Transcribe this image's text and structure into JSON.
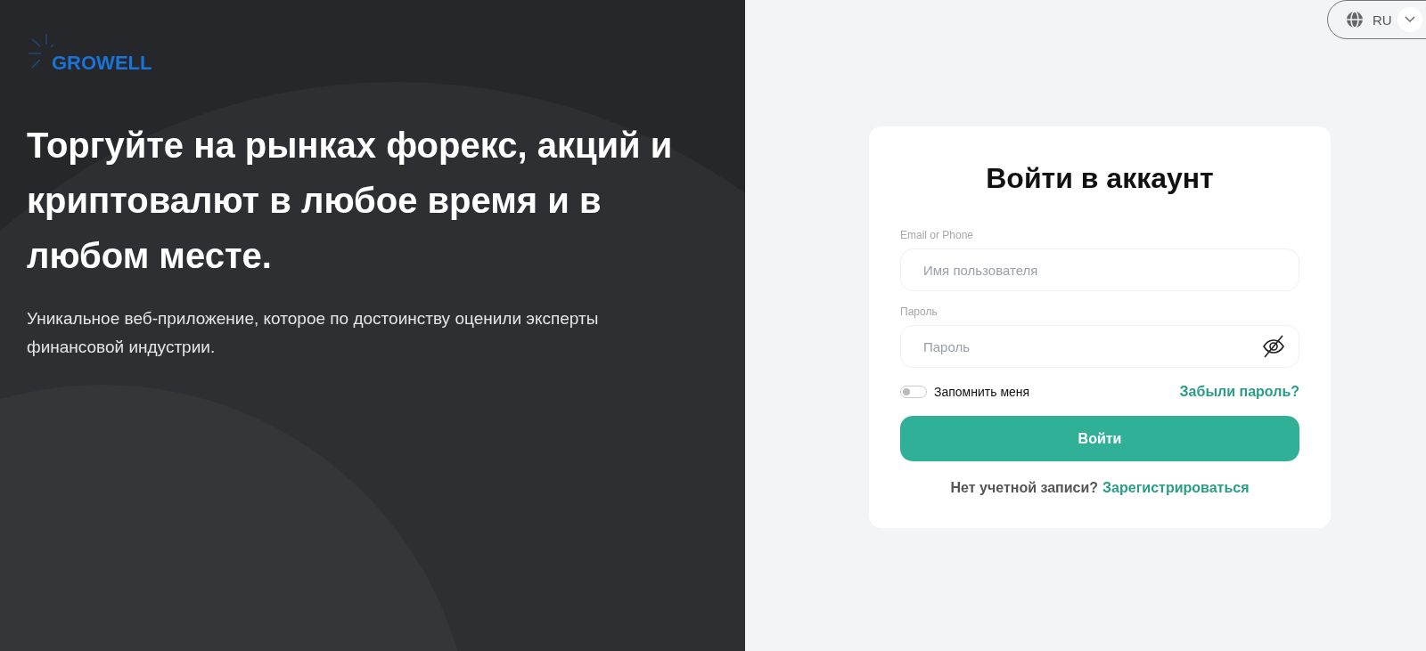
{
  "logo": {
    "text": "GROWELL"
  },
  "hero": {
    "title": "Торгуйте на рынках форекс, акций и криптовалют в любое время и в любом месте.",
    "subtitle": "Уникальное веб-приложение, которое по достоинству оценили эксперты финансовой индустрии."
  },
  "language": {
    "label": "RU"
  },
  "login": {
    "title": "Войти в аккаунт",
    "fields": [
      {
        "kind": "text",
        "label": "Email or Phone",
        "placeholder": "Имя пользователя"
      },
      {
        "kind": "password",
        "label": "Пароль",
        "placeholder": "Пароль"
      }
    ],
    "remember": {
      "label": "Запомнить меня",
      "on": false
    },
    "forgot": "Забыли пароль?",
    "submit": "Войти",
    "signup_prompt": "Нет учетной записи?",
    "signup_link": "Зарегистрироваться"
  }
}
